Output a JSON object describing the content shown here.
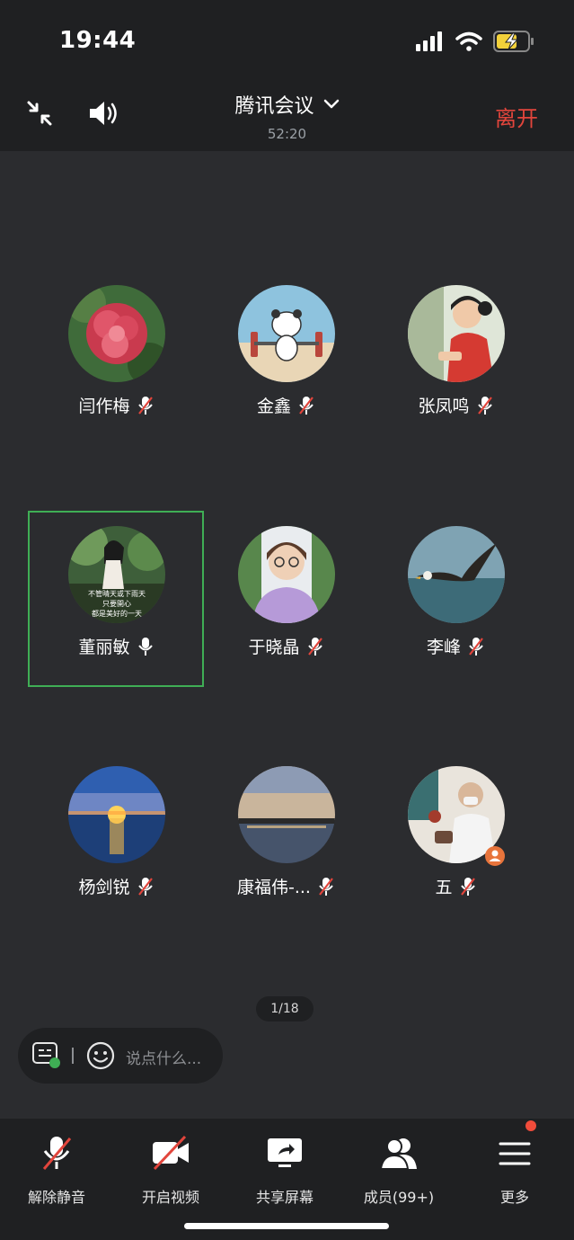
{
  "status_bar": {
    "time": "19:44"
  },
  "header": {
    "title": "腾讯会议",
    "duration": "52:20",
    "leave_label": "离开"
  },
  "participants": [
    {
      "name": "闫作梅",
      "mic": "muted"
    },
    {
      "name": "金鑫",
      "mic": "muted"
    },
    {
      "name": "张凤鸣",
      "mic": "muted"
    },
    {
      "name": "董丽敏",
      "mic": "on",
      "speaking": true,
      "avatar_caption": [
        "不管晴天或下雨天",
        "只要開心",
        "都是美好的一天"
      ]
    },
    {
      "name": "于晓晶",
      "mic": "muted"
    },
    {
      "name": "李峰",
      "mic": "muted"
    },
    {
      "name": "杨剑锐",
      "mic": "muted"
    },
    {
      "name": "康福伟-...",
      "mic": "muted"
    },
    {
      "name": "五",
      "mic": "muted",
      "host_badge": true
    }
  ],
  "pager": {
    "text": "1/18"
  },
  "chat": {
    "placeholder": "说点什么..."
  },
  "toolbar": {
    "unmute": "解除静音",
    "video": "开启视频",
    "share": "共享屏幕",
    "members": "成员(99+)",
    "more": "更多"
  },
  "colors": {
    "accent_green": "#3fae55",
    "leave_red": "#e2453c",
    "badge_red": "#f04c3b"
  }
}
